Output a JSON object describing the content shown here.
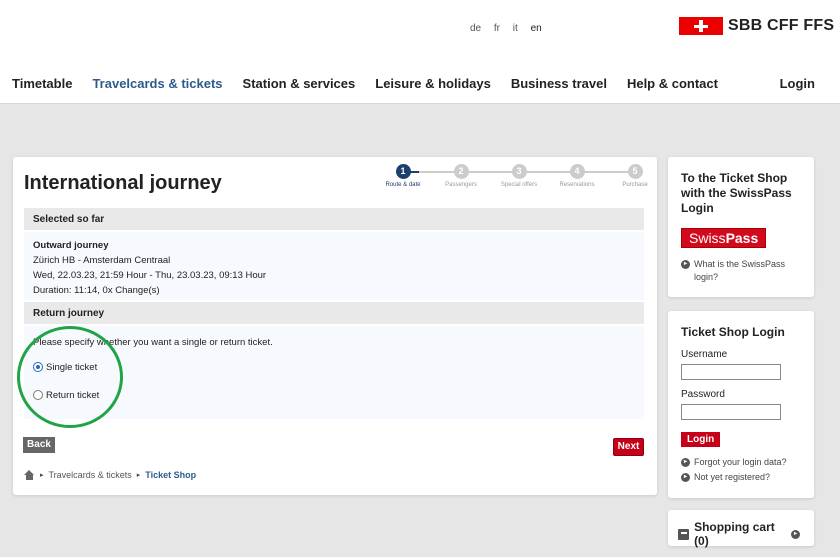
{
  "header": {
    "languages": [
      {
        "code": "de",
        "active": false
      },
      {
        "code": "fr",
        "active": false
      },
      {
        "code": "it",
        "active": false
      },
      {
        "code": "en",
        "active": true
      }
    ],
    "logo_text": "SBB CFF FFS",
    "nav": [
      "Timetable",
      "Travelcards & tickets",
      "Station & services",
      "Leisure & holidays",
      "Business travel",
      "Help & contact"
    ],
    "nav_active_index": 1,
    "login": "Login"
  },
  "main": {
    "title": "International journey",
    "steps": [
      {
        "number": "1",
        "label": "Route & date",
        "current": true
      },
      {
        "number": "2",
        "label": "Passengers",
        "current": false
      },
      {
        "number": "3",
        "label": "Special offers",
        "current": false
      },
      {
        "number": "4",
        "label": "Reservations",
        "current": false
      },
      {
        "number": "5",
        "label": "Purchase",
        "current": false
      }
    ],
    "selected_header": "Selected so far",
    "outward": {
      "heading": "Outward journey",
      "route": "Zürich HB - Amsterdam Centraal",
      "time": "Wed, 22.03.23, 21:59 Hour - Thu, 23.03.23, 09:13 Hour",
      "duration": "Duration: 11:14, 0x Change(s)"
    },
    "return_header": "Return journey",
    "prompt": "Please specify whether you want a single or return ticket.",
    "options": [
      {
        "label": "Single ticket",
        "selected": true
      },
      {
        "label": "Return ticket",
        "selected": false
      }
    ],
    "back": "Back",
    "next": "Next",
    "breadcrumb": [
      "Travelcards & tickets",
      "Ticket Shop"
    ]
  },
  "sidebar": {
    "swisspass": {
      "heading": "To the Ticket Shop with the SwissPass Login",
      "logo_left": "Swiss",
      "logo_right": "Pass",
      "link": "What is the SwissPass login?"
    },
    "login_box": {
      "heading": "Ticket Shop Login",
      "username_label": "Username",
      "password_label": "Password",
      "button": "Login",
      "forgot": "Forgot your login data?",
      "register": "Not yet registered?"
    },
    "cart": "Shopping cart (0)"
  },
  "colors": {
    "accent_blue": "#2d5b8c",
    "brand_red": "#eb0000",
    "button_red": "#c60018",
    "annotation_green": "#21a346"
  }
}
